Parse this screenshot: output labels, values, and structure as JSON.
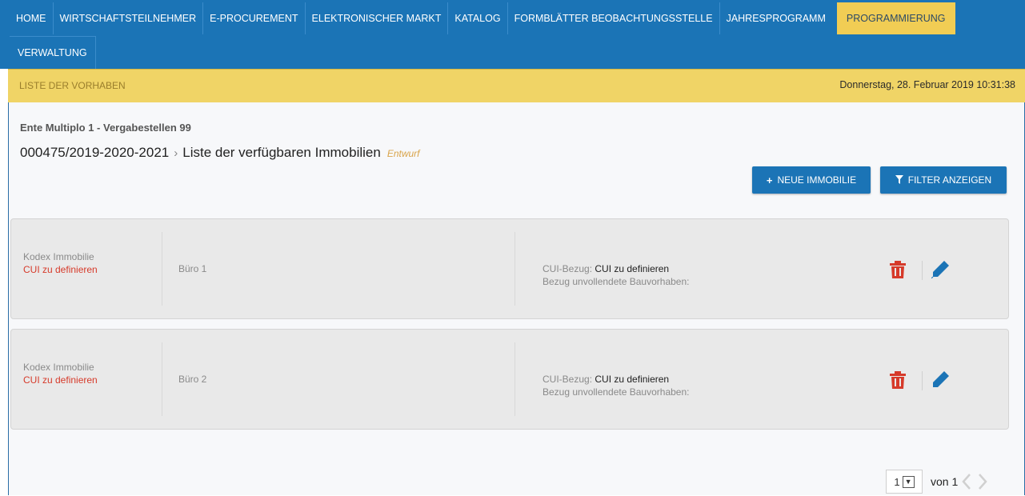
{
  "nav": {
    "items": [
      {
        "label": "HOME"
      },
      {
        "label": "WIRTSCHAFTSTEILNEHMER"
      },
      {
        "label": "E-PROCUREMENT"
      },
      {
        "label": "ELEKTRONISCHER MARKT"
      },
      {
        "label": "KATALOG"
      },
      {
        "label": "FORMBLÄTTER BEOBACHTUNGSSTELLE"
      },
      {
        "label": "JAHRESPROGRAMM"
      },
      {
        "label": "PROGRAMMIERUNG",
        "active": true
      }
    ],
    "row2": [
      {
        "label": "VERWALTUNG"
      }
    ]
  },
  "subbar": {
    "title": "LISTE DER VORHABEN",
    "datetime": "Donnerstag, 28. Februar 2019 10:31:38"
  },
  "page": {
    "org": "Ente Multiplo 1 - Vergabestellen 99",
    "program_code": "000475/2019-2020-2021",
    "title": "Liste der verfügbaren Immobilien",
    "status": "Entwurf"
  },
  "actions": {
    "new_label": "NEUE IMMOBILIE",
    "filter_label": "FILTER ANZEIGEN"
  },
  "properties": [
    {
      "code_label": "Kodex Immobilie",
      "code_value": "CUI zu definieren",
      "name": "Büro 1",
      "cui_label": "CUI-Bezug:",
      "cui_value": "CUI zu definieren",
      "unfinished_label": "Bezug unvollendete Bauvorhaben:"
    },
    {
      "code_label": "Kodex Immobilie",
      "code_value": "CUI zu definieren",
      "name": "Büro 2",
      "cui_label": "CUI-Bezug:",
      "cui_value": "CUI zu definieren",
      "unfinished_label": "Bezug unvollendete Bauvorhaben:"
    }
  ],
  "pagination": {
    "current": "1",
    "of_label": "von 1"
  },
  "colors": {
    "nav_bg": "#1b74b6",
    "active_tab": "#f1cd54",
    "subbar_bg": "#f0d466",
    "delete_icon": "#d63a2a",
    "edit_icon": "#1b74b6"
  }
}
